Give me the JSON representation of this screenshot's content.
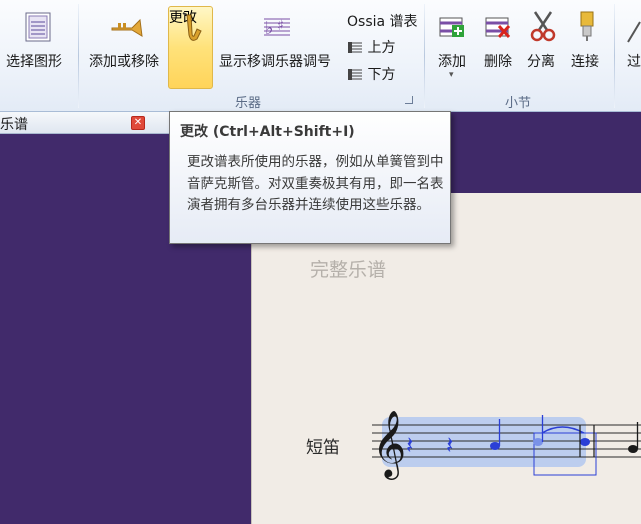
{
  "ribbon": {
    "select_graphics": "选择图形",
    "add_remove": "添加或移除",
    "change": "更改",
    "show_transposing": "显示移调乐器调号",
    "ossia_staff": "Ossia 谱表",
    "above": "上方",
    "below": "下方",
    "group_instruments": "乐器",
    "add": "添加",
    "delete": "删除",
    "split": "分离",
    "join": "连接",
    "group_bars": "小节",
    "cut_partial": "过"
  },
  "panel": {
    "title": "乐谱",
    "close_glyph": "✕"
  },
  "score": {
    "title": "完整乐谱",
    "instrument": "短笛"
  },
  "tooltip": {
    "title": "更改 (Ctrl+Alt+Shift+I)",
    "body": "更改谱表所使用的乐器，例如从单簧管到中音萨克斯管。对双重奏极其有用，即一名表演者拥有多台乐器并连续使用这些乐器。"
  },
  "colors": {
    "accent_active": "#ffd45a",
    "selection": "#a9c3f0",
    "note_blue": "#2b3fd6",
    "panel_bg": "#412a6b"
  },
  "icons": [
    "score-thumbnail-icon",
    "trumpet-icon",
    "saxophone-icon",
    "transposing-staff-icon",
    "ossia-above-icon",
    "ossia-below-icon",
    "add-bar-icon",
    "delete-bar-icon",
    "scissors-icon",
    "join-icon"
  ]
}
